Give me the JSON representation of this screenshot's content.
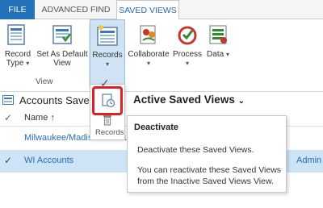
{
  "tabs": [
    {
      "label": "FILE"
    },
    {
      "label": "ADVANCED FIND"
    },
    {
      "label": "SAVED VIEWS"
    }
  ],
  "ribbon": {
    "record_type_label": "Record Type",
    "set_default_label": "Set As Default View",
    "records_label": "Records",
    "collaborate_label": "Collaborate",
    "process_label": "Process",
    "data_label": "Data",
    "group_label": "View"
  },
  "view": {
    "title": "Accounts Save",
    "active_views": "Active Saved Views"
  },
  "grid": {
    "column_name": "Name ↑",
    "rows": [
      {
        "name": "Milwaukee/Madison Accounts",
        "owner": ""
      },
      {
        "name": "WI Accounts",
        "owner": "Admin"
      }
    ]
  },
  "records_menu": {
    "label": "Records"
  },
  "tooltip": {
    "title": "Deactivate",
    "line1": "Deactivate these Saved Views.",
    "line2": "You can reactivate these Saved Views from the Inactive Saved Views View."
  },
  "colors": {
    "file_tab": "#2272b9",
    "selected_row": "#cde4f7",
    "highlight": "#e02020"
  }
}
